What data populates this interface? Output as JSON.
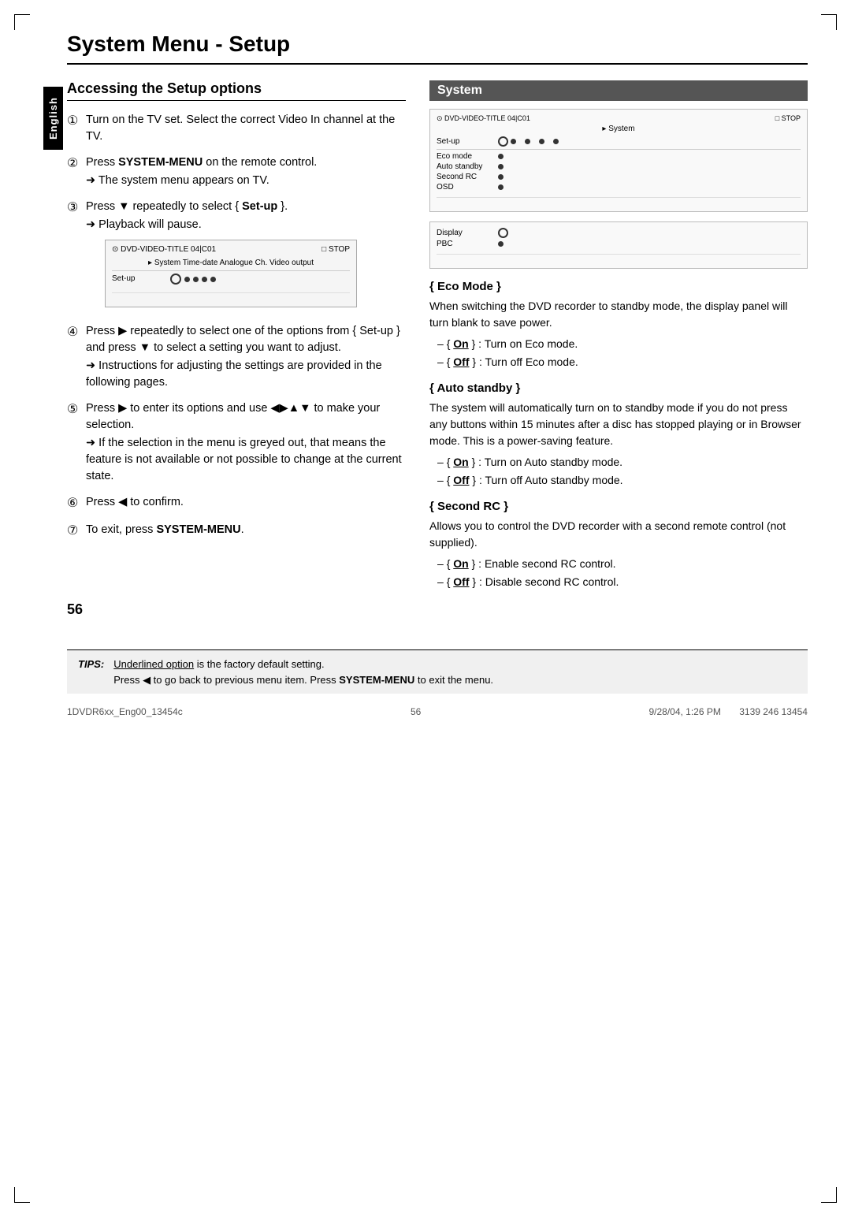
{
  "page": {
    "title": "System Menu - Setup",
    "page_number": "56",
    "footer_left": "1DVDR6xx_Eng00_13454c",
    "footer_center": "56",
    "footer_right_date": "9/28/04, 1:26 PM",
    "footer_right_code": "3139 246 13454"
  },
  "sidebar": {
    "label": "English"
  },
  "left_section": {
    "heading": "Accessing the Setup options",
    "steps": [
      {
        "number": "①",
        "text": "Turn on the TV set.  Select the correct Video In channel at the TV."
      },
      {
        "number": "②",
        "text": "Press SYSTEM-MENU on the remote control.",
        "arrow_text": "The system menu appears on TV."
      },
      {
        "number": "③",
        "text": "Press ▼ repeatedly to select { Set-up }.",
        "arrow_text": "Playback will pause."
      },
      {
        "number": "④",
        "text": "Press ▶ repeatedly to select one of the options from { Set-up } and press ▼ to select a setting you want to adjust.",
        "arrow_text": "Instructions for adjusting the settings are provided in the following pages."
      },
      {
        "number": "⑤",
        "text": "Press ▶ to enter its options and use ◀▶▲▼ to make your selection.",
        "arrow_text": "If the selection in the menu is greyed out, that means the feature is not available or not possible to change at the current state."
      },
      {
        "number": "⑥",
        "text": "Press ◀ to confirm."
      },
      {
        "number": "⑦",
        "text": "To exit, press SYSTEM-MENU."
      }
    ],
    "screen_step3": {
      "top_left": "DVD-VIDEO-TITLE 04|C01",
      "top_right": "STOP",
      "nav_items": [
        "System",
        "Time-date",
        "Analogue Ch.",
        "Video output"
      ],
      "menu_rows": [
        {
          "label": "Set-up",
          "has_icon": true,
          "dots": 4
        }
      ]
    }
  },
  "right_section": {
    "heading": "System",
    "diagram_top": {
      "left": "DVD-VIDEO-TITLE 04|C01",
      "right": "STOP"
    },
    "diagram_center_label": "System",
    "diagram_setup_row": {
      "label": "Set-up",
      "has_icon": true,
      "dot_count": 4
    },
    "diagram_menu_items": [
      {
        "label": "Eco mode",
        "has_dot": true
      },
      {
        "label": "Auto standby",
        "has_dot": true
      },
      {
        "label": "Second RC",
        "has_dot": true
      },
      {
        "label": "OSD",
        "has_dot": true
      }
    ],
    "diagram2_display_row": {
      "label": "Display",
      "has_icon": true
    },
    "diagram2_pbc_row": {
      "label": "PBC",
      "has_dot": true
    },
    "eco_mode": {
      "title": "{ Eco Mode }",
      "description": "When switching the DVD recorder to standby mode, the display panel will turn blank to save power.",
      "bullets": [
        "{ On } : Turn on Eco mode.",
        "{ Off } : Turn off Eco mode."
      ]
    },
    "auto_standby": {
      "title": "{ Auto standby }",
      "description": "The system will automatically turn on to standby mode if you do not press any buttons within 15 minutes after a disc has stopped playing or in Browser mode. This is a power-saving feature.",
      "bullets": [
        "{ On } : Turn on Auto standby mode.",
        "{ Off } : Turn off Auto standby mode."
      ]
    },
    "second_rc": {
      "title": "{ Second RC }",
      "description": "Allows you to control the DVD recorder with a second remote control (not supplied).",
      "bullets": [
        "{ On } : Enable second RC control.",
        "{ Off } : Disable second RC control."
      ]
    }
  },
  "tips": {
    "label": "TIPS:",
    "line1": "Underlined option is the factory default setting.",
    "line2": "Press ◀ to go back to previous menu item.  Press SYSTEM-MENU to exit the menu."
  }
}
